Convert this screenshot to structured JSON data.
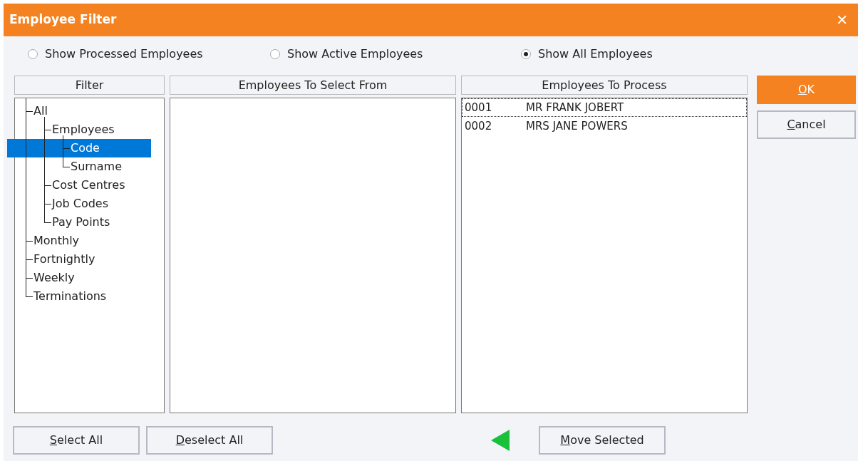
{
  "window": {
    "title": "Employee Filter",
    "close": "✕"
  },
  "radios": [
    {
      "label": "Show Processed Employees",
      "selected": false
    },
    {
      "label": "Show Active Employees",
      "selected": false
    },
    {
      "label": "Show All Employees",
      "selected": true
    }
  ],
  "filter": {
    "header": "Filter",
    "tree": [
      {
        "label": "All",
        "selected": false,
        "children": [
          {
            "label": "Employees",
            "selected": false,
            "children": [
              {
                "label": "Code",
                "selected": true
              },
              {
                "label": "Surname",
                "selected": false
              }
            ]
          },
          {
            "label": "Cost Centres",
            "selected": false
          },
          {
            "label": "Job Codes",
            "selected": false
          },
          {
            "label": "Pay Points",
            "selected": false
          }
        ]
      },
      {
        "label": "Monthly",
        "selected": false
      },
      {
        "label": "Fortnightly",
        "selected": false
      },
      {
        "label": "Weekly",
        "selected": false
      },
      {
        "label": "Terminations",
        "selected": false
      }
    ]
  },
  "select_from": {
    "header": "Employees To Select From"
  },
  "to_process": {
    "header": "Employees To Process",
    "rows": [
      {
        "code": "0001",
        "name": "MR FRANK JOBERT",
        "focused": true
      },
      {
        "code": "0002",
        "name": "MRS JANE POWERS",
        "focused": false
      }
    ]
  },
  "side_buttons": [
    {
      "key": "O",
      "rest": "K",
      "kind": "primary"
    },
    {
      "key": "C",
      "rest": "ancel",
      "kind": "plain"
    }
  ],
  "bottom_left_buttons": [
    {
      "key": "S",
      "rest": "elect All"
    },
    {
      "key": "D",
      "rest": "eselect All"
    }
  ],
  "move_button": {
    "key": "M",
    "rest": "ove Selected"
  }
}
